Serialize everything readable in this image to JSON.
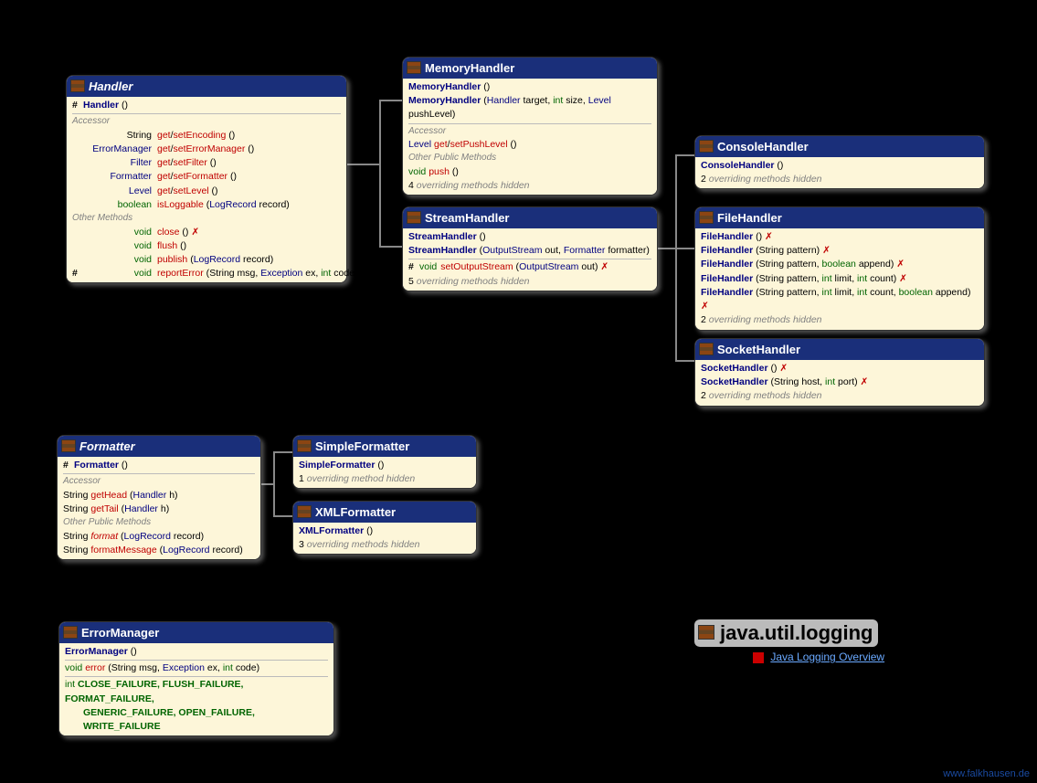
{
  "pkg": {
    "title": "java.util.logging",
    "link_label": "Java Logging Overview"
  },
  "watermark": "www.falkhausen.de",
  "handler": {
    "name": "Handler",
    "ctor": "Handler",
    "accessor_label": "Accessor",
    "other_label": "Other Methods",
    "accessors": [
      {
        "type": "String",
        "typeclass": "type-string",
        "get": "get",
        "set": "setEncoding"
      },
      {
        "type": "ErrorManager",
        "typeclass": "type-class",
        "get": "get",
        "set": "setErrorManager"
      },
      {
        "type": "Filter",
        "typeclass": "type-class",
        "get": "get",
        "set": "setFilter"
      },
      {
        "type": "Formatter",
        "typeclass": "type-class",
        "get": "get",
        "set": "setFormatter"
      },
      {
        "type": "Level",
        "typeclass": "type-class",
        "get": "get",
        "set": "setLevel"
      }
    ],
    "isLoggable": {
      "ret": "boolean",
      "name": "isLoggable",
      "ptype": "LogRecord",
      "pname": "record"
    },
    "others": [
      {
        "ret": "void",
        "name": "close",
        "throws": true
      },
      {
        "ret": "void",
        "name": "flush"
      },
      {
        "ret": "void",
        "name": "publish",
        "ptype": "LogRecord",
        "pname": "record"
      },
      {
        "ret": "void",
        "name": "reportError",
        "sig": "(String msg, Exception ex, int code)",
        "vis": "#"
      }
    ]
  },
  "memory": {
    "name": "MemoryHandler",
    "ctor1": "MemoryHandler",
    "ctor2_sig": "(Handler target, int size, Level  pushLevel)",
    "accessor_label": "Accessor",
    "pushlevel": {
      "ret": "Level",
      "get": "get",
      "set": "setPushLevel"
    },
    "other_label": "Other Public Methods",
    "push": {
      "ret": "void",
      "name": "push"
    },
    "hidden": {
      "n": "4",
      "text": " overriding methods hidden"
    }
  },
  "stream": {
    "name": "StreamHandler",
    "ctor1": "StreamHandler",
    "ctor2_sig": "(OutputStream out, Formatter formatter)",
    "setout": {
      "ret": "void",
      "name": "setOutputStream",
      "sig": "(OutputStream out)",
      "vis": "#"
    },
    "hidden": {
      "n": "5",
      "text": " overriding methods hidden"
    }
  },
  "console": {
    "name": "ConsoleHandler",
    "ctor": "ConsoleHandler",
    "hidden": {
      "n": "2",
      "text": " overriding methods hidden"
    }
  },
  "file": {
    "name": "FileHandler",
    "rows": [
      {
        "ctor": "FileHandler",
        "sig": "()",
        "throws": true
      },
      {
        "ctor": "FileHandler",
        "sig": "(String pattern)",
        "throws": true
      },
      {
        "ctor": "FileHandler",
        "sig": "(String pattern, boolean append)",
        "throws": true
      },
      {
        "ctor": "FileHandler",
        "sig": "(String pattern, int limit, int count)",
        "throws": true
      },
      {
        "ctor": "FileHandler",
        "sig": "(String pattern, int limit, int count, boolean append)",
        "throws": true
      }
    ],
    "hidden": {
      "n": "2",
      "text": " overriding methods hidden"
    }
  },
  "socket": {
    "name": "SocketHandler",
    "rows": [
      {
        "ctor": "SocketHandler",
        "sig": "()",
        "throws": true
      },
      {
        "ctor": "SocketHandler",
        "sig": "(String host, int port)",
        "throws": true
      }
    ],
    "hidden": {
      "n": "2",
      "text": " overriding methods hidden"
    }
  },
  "formatter": {
    "name": "Formatter",
    "ctor": "Formatter",
    "accessor_label": "Accessor",
    "accessors": [
      {
        "ret": "String",
        "name": "getHead",
        "ptype": "Handler",
        "pname": "h"
      },
      {
        "ret": "String",
        "name": "getTail",
        "ptype": "Handler",
        "pname": "h"
      }
    ],
    "other_label": "Other Public Methods",
    "others": [
      {
        "ret": "String",
        "name": "format",
        "ptype": "LogRecord",
        "pname": "record",
        "ital": true
      },
      {
        "ret": "String",
        "name": "formatMessage",
        "ptype": "LogRecord",
        "pname": "record"
      }
    ]
  },
  "simplefmt": {
    "name": "SimpleFormatter",
    "ctor": "SimpleFormatter",
    "hidden": {
      "n": "1",
      "text": " overriding method hidden"
    }
  },
  "xmlfmt": {
    "name": "XMLFormatter",
    "ctor": "XMLFormatter",
    "hidden": {
      "n": "3",
      "text": " overriding methods hidden"
    }
  },
  "errmgr": {
    "name": "ErrorManager",
    "ctor": "ErrorManager",
    "error": {
      "ret": "void",
      "name": "error",
      "sig": "(String msg, Exception ex, int code)"
    },
    "consts_prefix": "int",
    "consts_l1": "CLOSE_FAILURE, FLUSH_FAILURE, FORMAT_FAILURE,",
    "consts_l2": "GENERIC_FAILURE, OPEN_FAILURE, WRITE_FAILURE"
  }
}
